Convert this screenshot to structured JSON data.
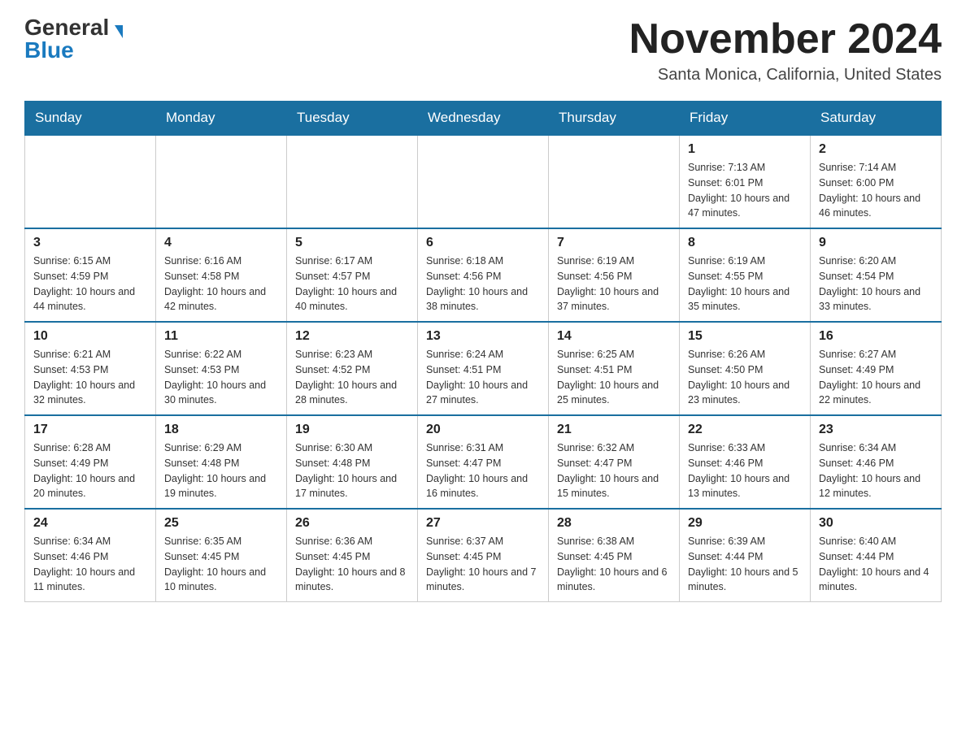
{
  "header": {
    "logo_general": "General",
    "logo_blue": "Blue",
    "month_title": "November 2024",
    "location": "Santa Monica, California, United States"
  },
  "days_of_week": [
    "Sunday",
    "Monday",
    "Tuesday",
    "Wednesday",
    "Thursday",
    "Friday",
    "Saturday"
  ],
  "weeks": [
    [
      {
        "day": "",
        "info": ""
      },
      {
        "day": "",
        "info": ""
      },
      {
        "day": "",
        "info": ""
      },
      {
        "day": "",
        "info": ""
      },
      {
        "day": "",
        "info": ""
      },
      {
        "day": "1",
        "info": "Sunrise: 7:13 AM\nSunset: 6:01 PM\nDaylight: 10 hours and 47 minutes."
      },
      {
        "day": "2",
        "info": "Sunrise: 7:14 AM\nSunset: 6:00 PM\nDaylight: 10 hours and 46 minutes."
      }
    ],
    [
      {
        "day": "3",
        "info": "Sunrise: 6:15 AM\nSunset: 4:59 PM\nDaylight: 10 hours and 44 minutes."
      },
      {
        "day": "4",
        "info": "Sunrise: 6:16 AM\nSunset: 4:58 PM\nDaylight: 10 hours and 42 minutes."
      },
      {
        "day": "5",
        "info": "Sunrise: 6:17 AM\nSunset: 4:57 PM\nDaylight: 10 hours and 40 minutes."
      },
      {
        "day": "6",
        "info": "Sunrise: 6:18 AM\nSunset: 4:56 PM\nDaylight: 10 hours and 38 minutes."
      },
      {
        "day": "7",
        "info": "Sunrise: 6:19 AM\nSunset: 4:56 PM\nDaylight: 10 hours and 37 minutes."
      },
      {
        "day": "8",
        "info": "Sunrise: 6:19 AM\nSunset: 4:55 PM\nDaylight: 10 hours and 35 minutes."
      },
      {
        "day": "9",
        "info": "Sunrise: 6:20 AM\nSunset: 4:54 PM\nDaylight: 10 hours and 33 minutes."
      }
    ],
    [
      {
        "day": "10",
        "info": "Sunrise: 6:21 AM\nSunset: 4:53 PM\nDaylight: 10 hours and 32 minutes."
      },
      {
        "day": "11",
        "info": "Sunrise: 6:22 AM\nSunset: 4:53 PM\nDaylight: 10 hours and 30 minutes."
      },
      {
        "day": "12",
        "info": "Sunrise: 6:23 AM\nSunset: 4:52 PM\nDaylight: 10 hours and 28 minutes."
      },
      {
        "day": "13",
        "info": "Sunrise: 6:24 AM\nSunset: 4:51 PM\nDaylight: 10 hours and 27 minutes."
      },
      {
        "day": "14",
        "info": "Sunrise: 6:25 AM\nSunset: 4:51 PM\nDaylight: 10 hours and 25 minutes."
      },
      {
        "day": "15",
        "info": "Sunrise: 6:26 AM\nSunset: 4:50 PM\nDaylight: 10 hours and 23 minutes."
      },
      {
        "day": "16",
        "info": "Sunrise: 6:27 AM\nSunset: 4:49 PM\nDaylight: 10 hours and 22 minutes."
      }
    ],
    [
      {
        "day": "17",
        "info": "Sunrise: 6:28 AM\nSunset: 4:49 PM\nDaylight: 10 hours and 20 minutes."
      },
      {
        "day": "18",
        "info": "Sunrise: 6:29 AM\nSunset: 4:48 PM\nDaylight: 10 hours and 19 minutes."
      },
      {
        "day": "19",
        "info": "Sunrise: 6:30 AM\nSunset: 4:48 PM\nDaylight: 10 hours and 17 minutes."
      },
      {
        "day": "20",
        "info": "Sunrise: 6:31 AM\nSunset: 4:47 PM\nDaylight: 10 hours and 16 minutes."
      },
      {
        "day": "21",
        "info": "Sunrise: 6:32 AM\nSunset: 4:47 PM\nDaylight: 10 hours and 15 minutes."
      },
      {
        "day": "22",
        "info": "Sunrise: 6:33 AM\nSunset: 4:46 PM\nDaylight: 10 hours and 13 minutes."
      },
      {
        "day": "23",
        "info": "Sunrise: 6:34 AM\nSunset: 4:46 PM\nDaylight: 10 hours and 12 minutes."
      }
    ],
    [
      {
        "day": "24",
        "info": "Sunrise: 6:34 AM\nSunset: 4:46 PM\nDaylight: 10 hours and 11 minutes."
      },
      {
        "day": "25",
        "info": "Sunrise: 6:35 AM\nSunset: 4:45 PM\nDaylight: 10 hours and 10 minutes."
      },
      {
        "day": "26",
        "info": "Sunrise: 6:36 AM\nSunset: 4:45 PM\nDaylight: 10 hours and 8 minutes."
      },
      {
        "day": "27",
        "info": "Sunrise: 6:37 AM\nSunset: 4:45 PM\nDaylight: 10 hours and 7 minutes."
      },
      {
        "day": "28",
        "info": "Sunrise: 6:38 AM\nSunset: 4:45 PM\nDaylight: 10 hours and 6 minutes."
      },
      {
        "day": "29",
        "info": "Sunrise: 6:39 AM\nSunset: 4:44 PM\nDaylight: 10 hours and 5 minutes."
      },
      {
        "day": "30",
        "info": "Sunrise: 6:40 AM\nSunset: 4:44 PM\nDaylight: 10 hours and 4 minutes."
      }
    ]
  ]
}
